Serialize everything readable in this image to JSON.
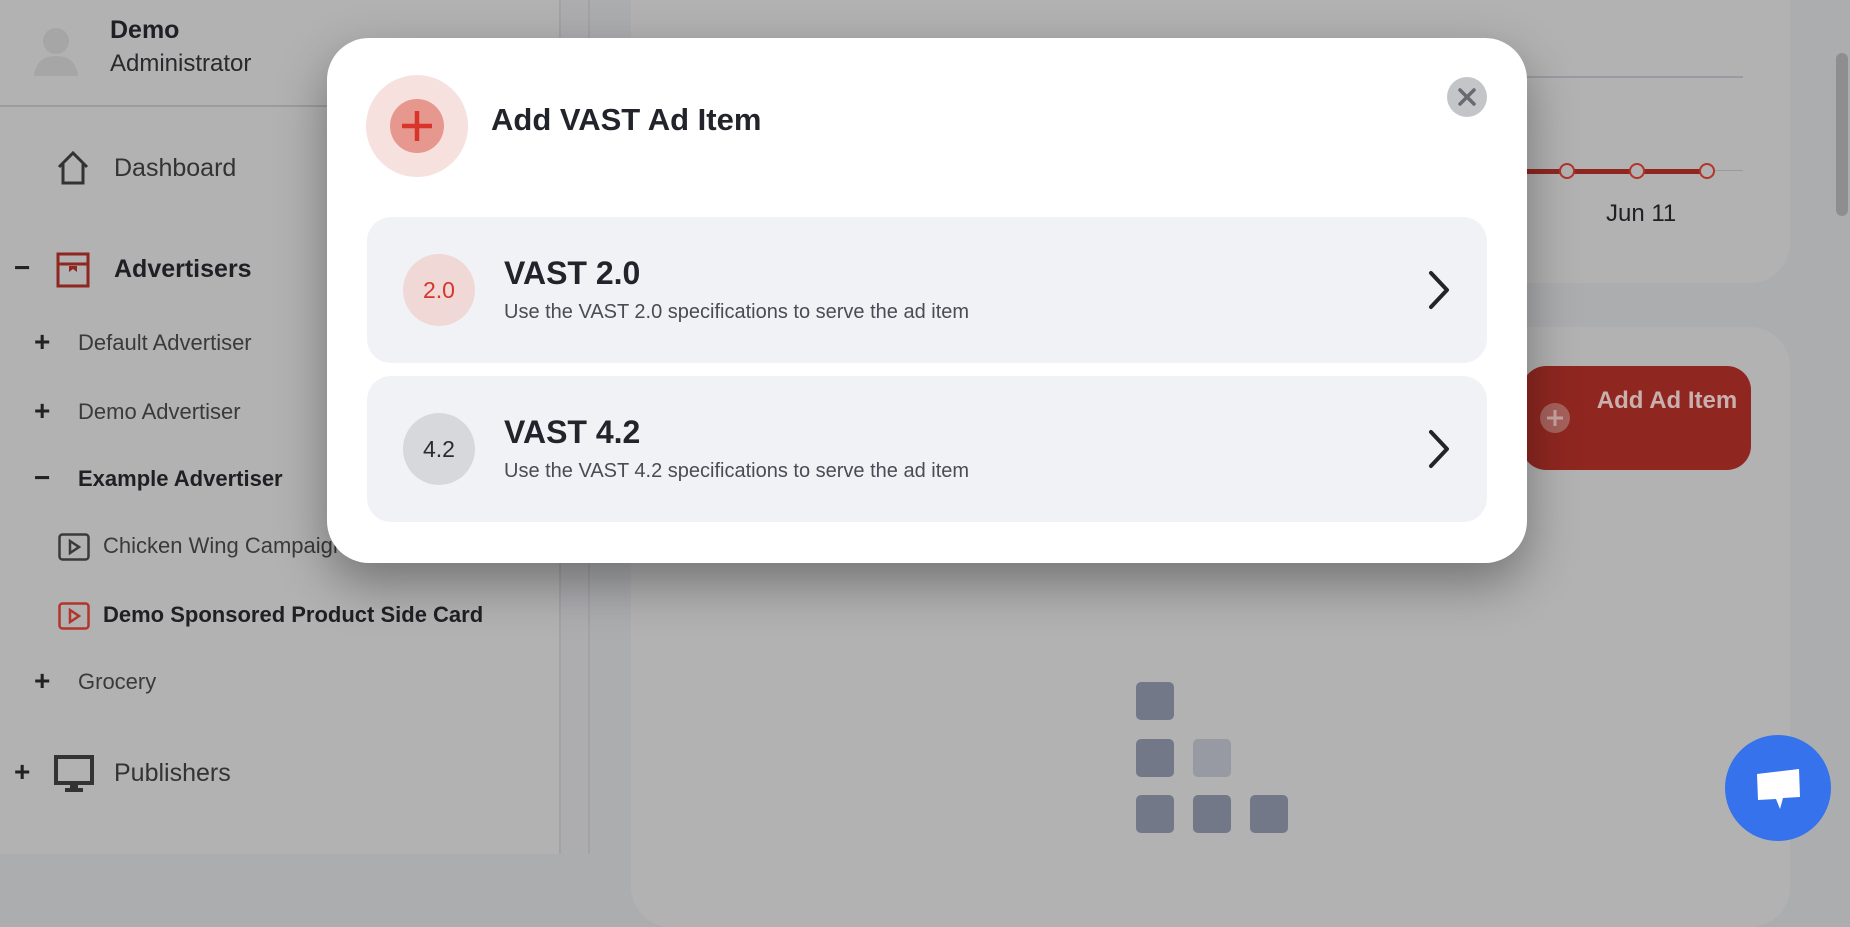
{
  "user": {
    "name": "Demo",
    "role": "Administrator"
  },
  "sidebar": {
    "dashboard": "Dashboard",
    "advertisers": {
      "label": "Advertisers",
      "toggle": "−",
      "items": [
        {
          "label": "Default Advertiser",
          "toggle": "+"
        },
        {
          "label": "Demo Advertiser",
          "toggle": "+"
        },
        {
          "label": "Example Advertiser",
          "toggle": "−",
          "children": [
            {
              "label": "Chicken Wing Campaign"
            },
            {
              "label": "Demo Sponsored Product Side Card"
            }
          ]
        },
        {
          "label": "Grocery",
          "toggle": "+"
        }
      ]
    },
    "publishers": {
      "label": "Publishers",
      "toggle": "+"
    }
  },
  "background": {
    "chart_tick": "Jun 11",
    "add_button": "Add Ad Item"
  },
  "modal": {
    "title": "Add VAST Ad Item",
    "options": [
      {
        "badge": "2.0",
        "title": "VAST 2.0",
        "description": "Use the VAST 2.0 specifications to serve the ad item"
      },
      {
        "badge": "4.2",
        "title": "VAST 4.2",
        "description": "Use the VAST 4.2 specifications to serve the ad item"
      }
    ]
  },
  "colors": {
    "accent": "#e03a2e",
    "brand_dark": "#8f2720",
    "chat": "#3572ec"
  }
}
